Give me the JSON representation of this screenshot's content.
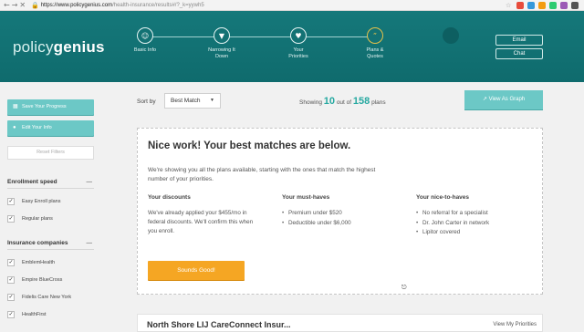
{
  "browser": {
    "url_host": "https://www.policygenius.com",
    "url_path": "/health-insurance/results#/?_k=yywh5"
  },
  "header": {
    "logo_light": "policy",
    "logo_bold": "genius",
    "steps": [
      {
        "label": "Basic Info",
        "icon": "person-icon",
        "glyph": "☺"
      },
      {
        "label": "Narrowing It Down",
        "icon": "funnel-icon",
        "glyph": "▼"
      },
      {
        "label": "Your Priorities",
        "icon": "heart-icon",
        "glyph": "♥"
      },
      {
        "label": "Plans & Quotes",
        "icon": "quote-icon",
        "glyph": "”"
      },
      {
        "label": "",
        "icon": "future-step-icon",
        "glyph": ""
      }
    ],
    "email_label": "Email",
    "chat_label": "Chat"
  },
  "sidebar": {
    "save_label": "Save Your Progress",
    "edit_label": "Edit Your Info",
    "reset_label": "Reset Filters",
    "enrollment": {
      "title": "Enrollment speed",
      "items": [
        "Easy Enroll plans",
        "Regular plans"
      ]
    },
    "companies": {
      "title": "Insurance companies",
      "items": [
        "EmblemHealth",
        "Empire BlueCross",
        "Fidelis Care New York",
        "HealthFirst"
      ]
    }
  },
  "main": {
    "sort_label": "Sort by",
    "sort_value": "Best Match",
    "showing_prefix": "Showing",
    "showing_count": "10",
    "showing_mid": "out of",
    "showing_total": "158",
    "showing_suffix": "plans",
    "graph_label": "View As Graph",
    "card": {
      "title": "Nice work! Your best matches are below.",
      "intro": "We're showing you all the plans available, starting with the ones that match the highest number of your priorities.",
      "discounts_title": "Your discounts",
      "discounts_body": "We've already applied your $455/mo in federal discounts. We'll confirm this when you enroll.",
      "must_title": "Your must-haves",
      "must_items": [
        "Premium under $520",
        "Deductible under $6,000"
      ],
      "nice_title": "Your nice-to-haves",
      "nice_items": [
        "No referral for a specialist",
        "Dr. John Carter in network",
        "Lipitor covered"
      ],
      "button_label": "Sounds Good!"
    },
    "next_plan_title": "North Shore LIJ CareConnect Insur...",
    "next_plan_right": "View My Priorities"
  },
  "colors": {
    "brand_teal": "#15787a",
    "accent_teal": "#6cc8c6",
    "count_teal": "#27a9a1",
    "cta_orange": "#f5a623"
  }
}
